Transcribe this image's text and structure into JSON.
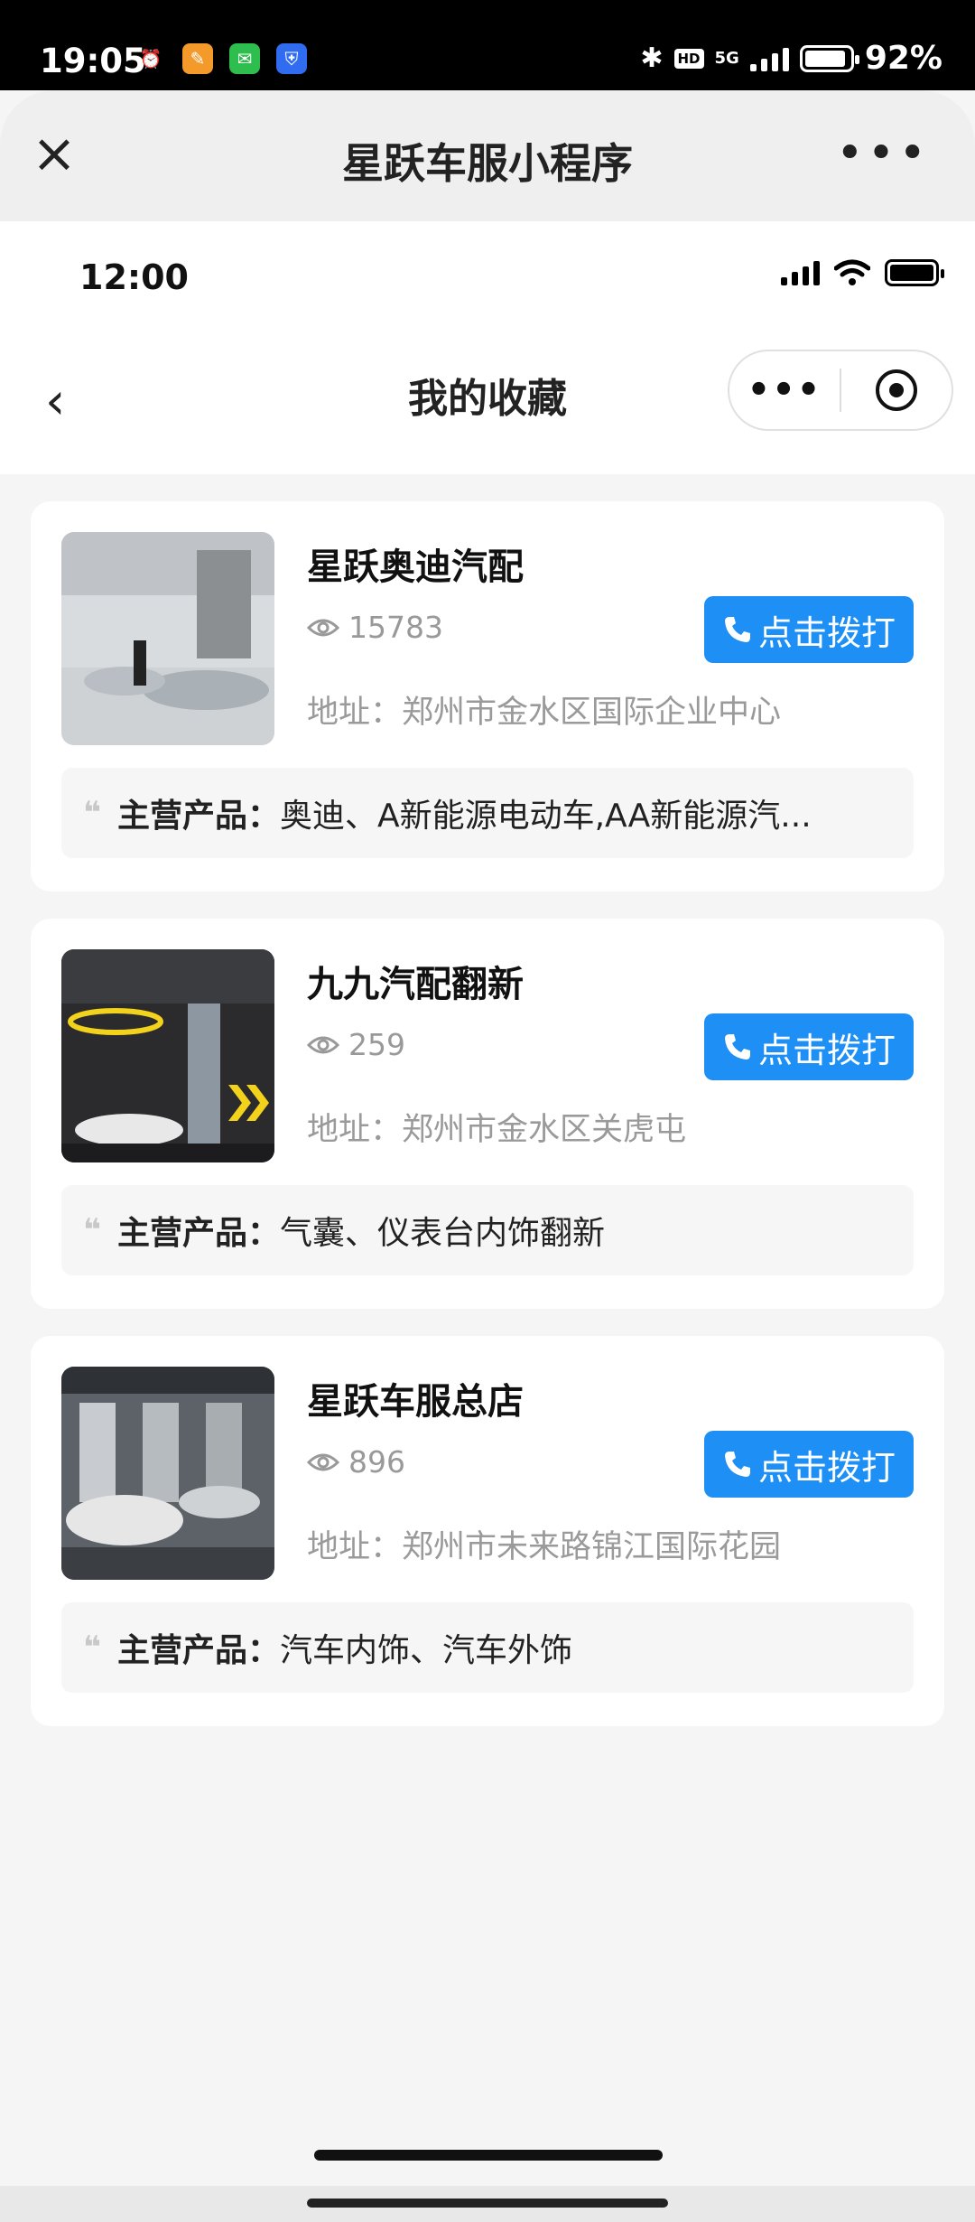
{
  "system_status": {
    "time": "19:05",
    "network": "5G",
    "hd": "HD",
    "battery": "92%",
    "battery_level": 0.92
  },
  "miniprogram_header": {
    "title": "星跃车服小程序"
  },
  "inner_status": {
    "time": "12:00"
  },
  "nav": {
    "title": "我的收藏"
  },
  "favorites": [
    {
      "name": "星跃奥迪汽配",
      "views": "15783",
      "call_label": "点击拨打",
      "address": "地址：郑州市金水区国际企业中心",
      "products_label": "主营产品：",
      "products": "奥迪、A新能源电动车,AA新能源汽..."
    },
    {
      "name": "九九汽配翻新",
      "views": "259",
      "call_label": "点击拨打",
      "address": "地址：郑州市金水区关虎屯",
      "products_label": "主营产品：",
      "products": "气囊、仪表台内饰翻新"
    },
    {
      "name": "星跃车服总店",
      "views": "896",
      "call_label": "点击拨打",
      "address": "地址：郑州市未来路锦江国际花园",
      "products_label": "主营产品：",
      "products": "汽车内饰、汽车外饰"
    }
  ],
  "colors": {
    "call_button": "#1e90f5",
    "page_bg": "#f5f5f5"
  }
}
